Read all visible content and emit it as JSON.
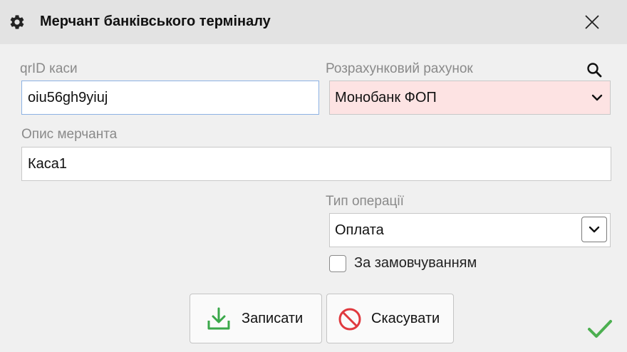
{
  "window": {
    "title": "Мерчант банківського терміналу",
    "title_icon": "gear-icon",
    "close_icon": "close-icon"
  },
  "form": {
    "qr_id": {
      "label": "qrID каси",
      "value": "oiu56gh9yiuj"
    },
    "account": {
      "label": "Розрахунковий рахунок",
      "value": "Монобанк ФОП",
      "background": "#fde3e3",
      "search_icon": "search-icon"
    },
    "description": {
      "label": "Опис мерчанта",
      "value": "Каса1"
    },
    "operation_type": {
      "label": "Тип операції",
      "value": "Оплата"
    },
    "default_checkbox": {
      "label": "За замовчуванням",
      "checked": false
    }
  },
  "buttons": {
    "save": {
      "label": "Записати",
      "icon": "download-icon",
      "color": "#3aa84a"
    },
    "cancel": {
      "label": "Скасувати",
      "icon": "no-entry-icon",
      "color": "#e0393e"
    }
  },
  "status": {
    "icon": "check-icon",
    "color": "#4caf50"
  }
}
